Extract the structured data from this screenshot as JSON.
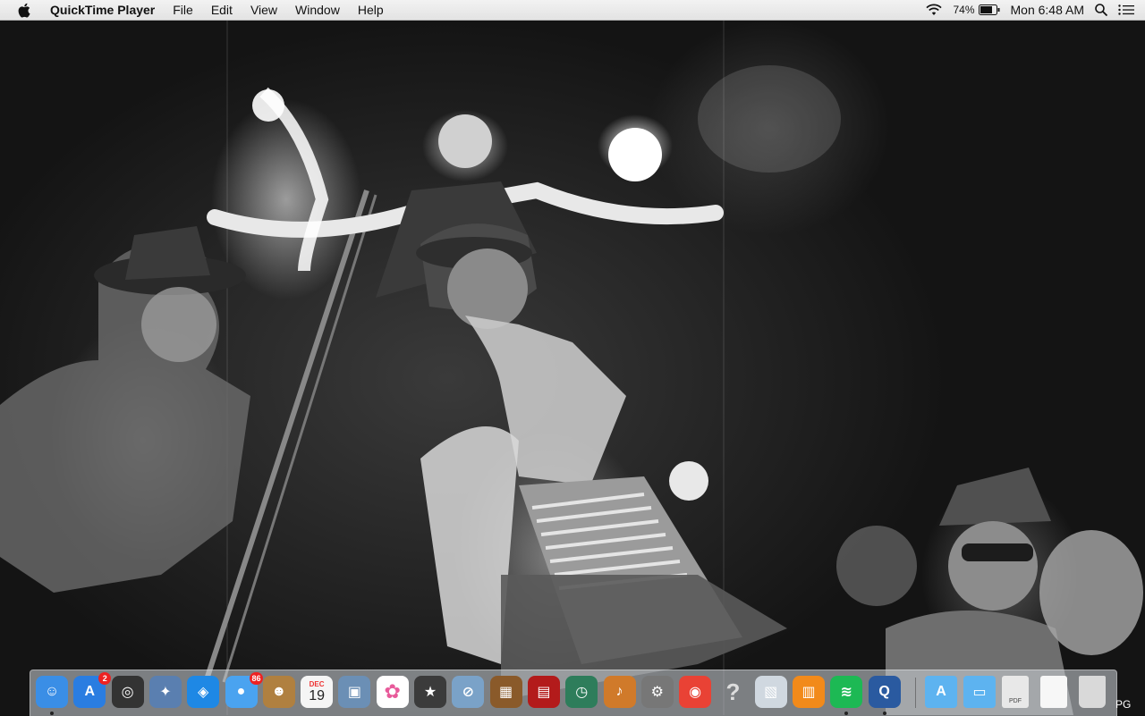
{
  "menubar": {
    "app_name": "QuickTime Player",
    "menus": [
      "File",
      "Edit",
      "View",
      "Window",
      "Help"
    ],
    "battery_percent": "74%",
    "clock": "Mon 6:48 AM",
    "icons": [
      "apple-icon",
      "wifi-icon",
      "battery-icon",
      "spotlight-search-icon",
      "notification-center-icon"
    ]
  },
  "desktop": {
    "wallpaper": "black-and-white photo of a jug band performing with fire",
    "truncated_label": "PG"
  },
  "dock": {
    "apps": [
      {
        "name": "Finder",
        "icon": "finder-icon",
        "color": "#3a8ee6",
        "running": true
      },
      {
        "name": "App Store",
        "icon": "app-store-icon",
        "color": "#2a7de1",
        "badge": "2"
      },
      {
        "name": "Dashboard",
        "icon": "dashboard-icon",
        "color": "#333333"
      },
      {
        "name": "Image Capture",
        "icon": "image-capture-icon",
        "color": "#5a7fb0"
      },
      {
        "name": "Safari",
        "icon": "safari-icon",
        "color": "#1e88e5"
      },
      {
        "name": "Messages",
        "icon": "messages-icon",
        "color": "#4aa3f0",
        "badge": "86"
      },
      {
        "name": "Contacts",
        "icon": "contacts-icon",
        "color": "#b08040"
      },
      {
        "name": "Calendar",
        "icon": "calendar-icon",
        "color": "#f5f5f5",
        "month": "DEC",
        "day": "19"
      },
      {
        "name": "Preview",
        "icon": "preview-icon",
        "color": "#6b8fb5"
      },
      {
        "name": "Photos",
        "icon": "photos-icon",
        "color": "#ffffff"
      },
      {
        "name": "iMovie",
        "icon": "imovie-icon",
        "color": "#3b3b3b"
      },
      {
        "name": "Disk Utility",
        "icon": "disk-utility-icon",
        "color": "#7aa2c8"
      },
      {
        "name": "Photo Booth",
        "icon": "photo-booth-icon",
        "color": "#8a5a2a"
      },
      {
        "name": "Photo Booth Film",
        "icon": "photo-booth-film-icon",
        "color": "#b31b1b"
      },
      {
        "name": "Time Machine",
        "icon": "time-machine-icon",
        "color": "#2e7d5b"
      },
      {
        "name": "GarageBand",
        "icon": "garageband-icon",
        "color": "#d07a2a"
      },
      {
        "name": "System Preferences",
        "icon": "system-preferences-icon",
        "color": "#777777"
      },
      {
        "name": "Google Chrome",
        "icon": "chrome-icon",
        "color": "#e94235"
      },
      {
        "name": "Help",
        "icon": "question-mark-icon",
        "color": "#cccccc"
      },
      {
        "name": "Image Viewer",
        "icon": "image-viewer-icon",
        "color": "#d0d8e0"
      },
      {
        "name": "iBooks",
        "icon": "ibooks-icon",
        "color": "#f28a1a"
      },
      {
        "name": "Spotify",
        "icon": "spotify-icon",
        "color": "#1db954",
        "running": true
      },
      {
        "name": "QuickTime Player",
        "icon": "quicktime-icon",
        "color": "#2a5aa0",
        "running": true
      }
    ],
    "folders": [
      {
        "name": "Applications",
        "icon": "applications-folder-icon",
        "color": "#5db3f0"
      },
      {
        "name": "Documents",
        "icon": "documents-folder-icon",
        "color": "#5db3f0"
      },
      {
        "name": "PDF",
        "icon": "pdf-file-icon",
        "color": "#e8e8e8",
        "label": "PDF"
      },
      {
        "name": "Document",
        "icon": "blank-document-icon",
        "color": "#f7f7f7"
      },
      {
        "name": "Trash",
        "icon": "trash-icon",
        "color": "#d9d9d9"
      }
    ]
  }
}
